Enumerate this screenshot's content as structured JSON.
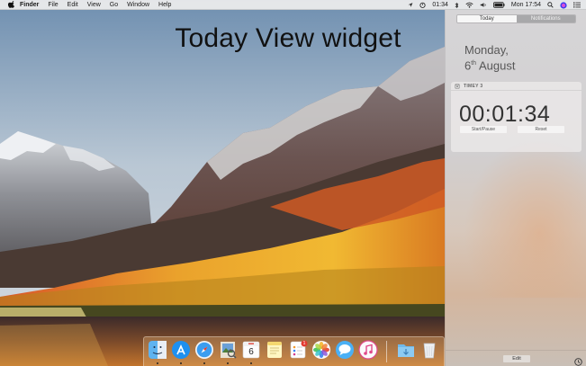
{
  "menubar": {
    "apple_icon": "apple-logo-icon",
    "items": [
      "Finder",
      "File",
      "Edit",
      "View",
      "Go",
      "Window",
      "Help"
    ],
    "time": "01:34",
    "clock": "Mon 17:54",
    "status_icons": [
      "location-icon",
      "timer-icon",
      "bluetooth-icon",
      "wifi-icon",
      "volume-icon",
      "battery-icon",
      "search-icon",
      "siri-icon",
      "notification-center-icon"
    ]
  },
  "overlay": {
    "title": "Today View widget"
  },
  "notification_center": {
    "tabs": [
      "Today",
      "Notifications"
    ],
    "active_tab": "Today",
    "date_line1": "Monday,",
    "date_day": "6",
    "date_suffix": "th",
    "date_month": " August",
    "widget": {
      "name": "TIMEY 3",
      "icon": "timer-app-icon",
      "time": "00:01:34",
      "buttons": [
        "Start/Pause",
        "Reset"
      ]
    },
    "edit_label": "Edit",
    "settings_icon": "settings-icon"
  },
  "dock": {
    "items": [
      "finder-icon",
      "app-store-icon",
      "safari-icon",
      "preview-icon",
      "calendar-icon",
      "notes-icon",
      "reminders-icon",
      "photos-icon",
      "messages-icon",
      "itunes-icon",
      "downloads-folder-icon",
      "trash-icon"
    ],
    "calendar_day": "6",
    "reminders_badge": "1"
  },
  "colors": {
    "menubar": "#ececec",
    "nc_panel": "#d3d1d2",
    "dock_tint": "#e6b478"
  }
}
